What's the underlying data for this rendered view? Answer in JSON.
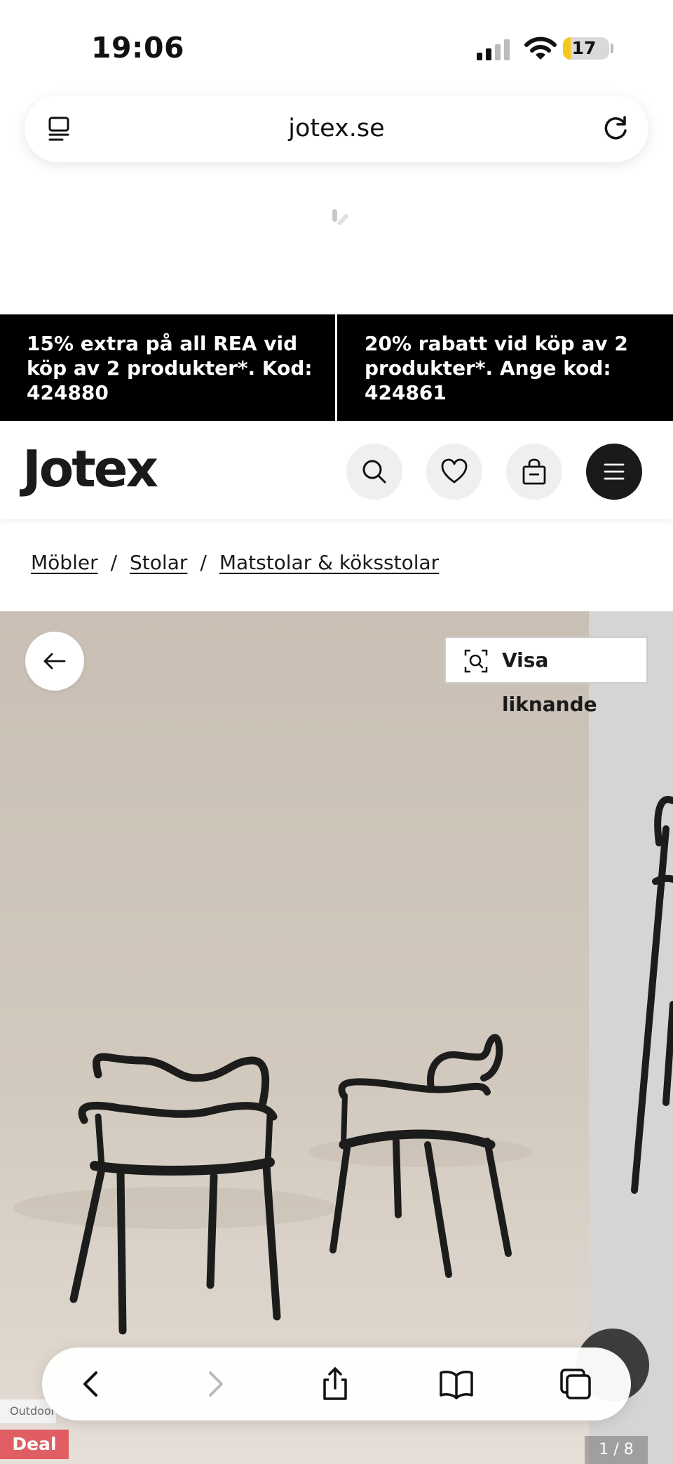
{
  "status_bar": {
    "time": "19:06",
    "battery": "17",
    "battery_color": "#f5c71a"
  },
  "browser": {
    "url": "jotex.se",
    "tabs_icon": "tab-overview-icon",
    "reload_icon": "reload-icon"
  },
  "promo": {
    "left": "15% extra på all REA vid köp av 2 produkter*. Kod: 424880",
    "right": "20% rabatt vid köp av 2 produkter*. Ange kod: 424861"
  },
  "header": {
    "logo": "Jotex",
    "icons": [
      "search-icon",
      "heart-icon",
      "bag-icon",
      "menu-icon"
    ]
  },
  "breadcrumb": {
    "items": [
      "Möbler",
      "Stolar",
      "Matstolar & köksstolar"
    ],
    "separator": "/"
  },
  "product": {
    "similar_button": "Visa liknande",
    "image_counter": "1 / 8",
    "deal_badge": "Deal",
    "side_label": "Outdoor"
  },
  "safari_toolbar": {
    "icons": [
      "back-icon",
      "forward-icon",
      "share-icon",
      "bookmarks-icon",
      "tabs-icon"
    ]
  }
}
